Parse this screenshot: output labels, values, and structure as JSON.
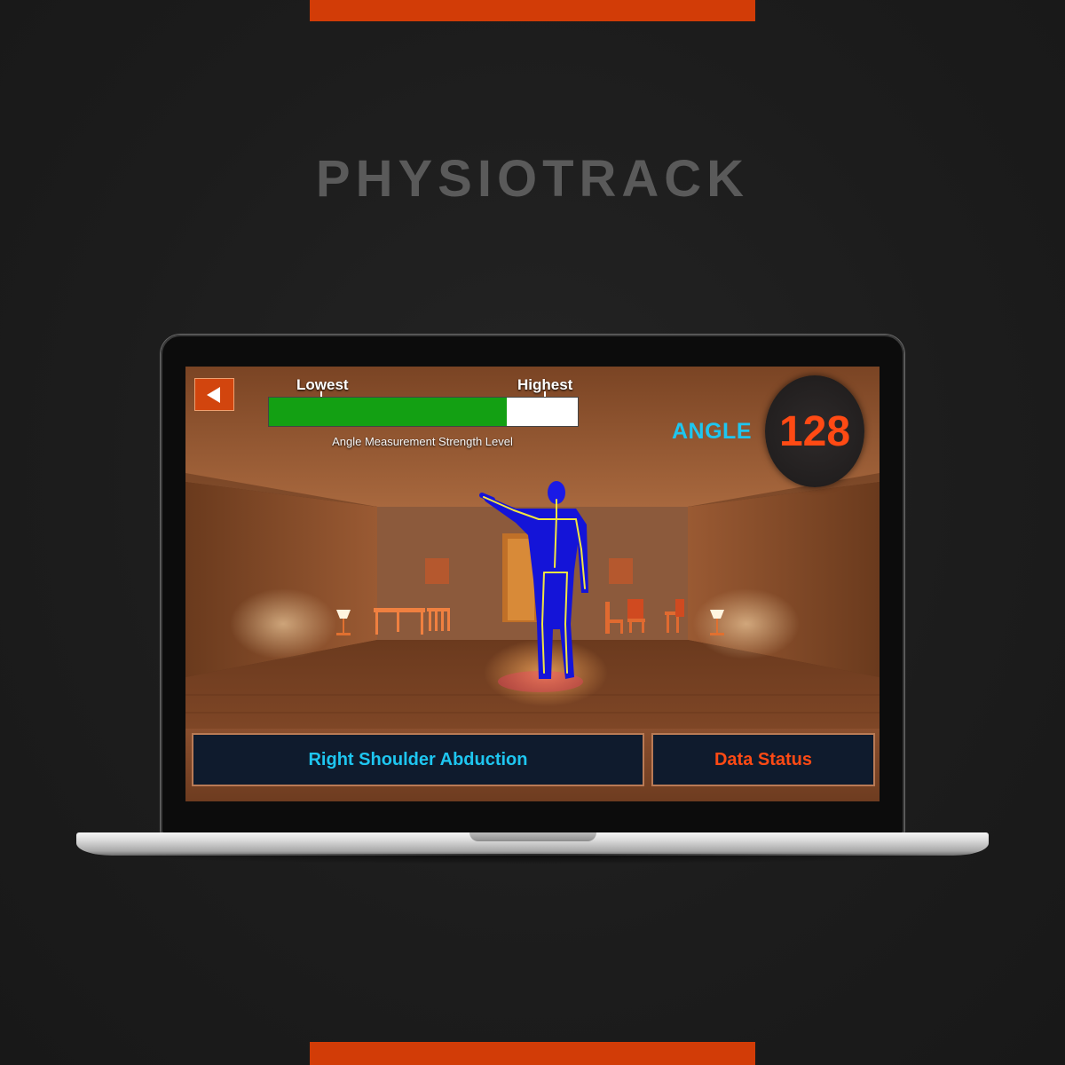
{
  "brand": {
    "title": "PHYSIOTRACK",
    "accent_color": "#d23c07"
  },
  "app": {
    "back_icon": "back-arrow-icon",
    "strength_meter": {
      "low_label": "Lowest",
      "high_label": "Highest",
      "caption": "Angle Measurement Strength Level",
      "level_fraction": 0.77,
      "fill_color": "#13a013"
    },
    "angle": {
      "label": "ANGLE",
      "value": "128",
      "label_color": "#1ec6f0",
      "value_color": "#ff4a14"
    },
    "exercise": {
      "name": "Right Shoulder Abduction"
    },
    "status": {
      "label": "Data Status"
    }
  }
}
